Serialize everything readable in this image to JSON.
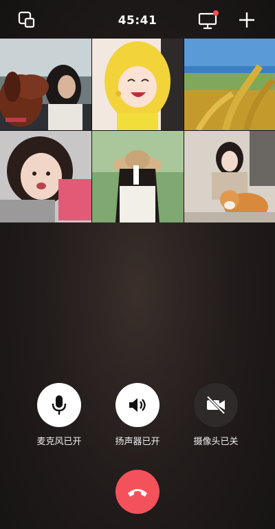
{
  "topbar": {
    "timer": "45:41",
    "icons": [
      "minimize-window-icon",
      "screen-share-icon",
      "add-icon"
    ],
    "notification_dot_color": "#ff4d4f"
  },
  "participants": [
    {
      "id": 1,
      "description": "dog and woman in car"
    },
    {
      "id": 2,
      "description": "cartoon girl avatar"
    },
    {
      "id": 3,
      "description": "rice field"
    },
    {
      "id": 4,
      "description": "child with toy"
    },
    {
      "id": 5,
      "description": "girl with straw hat"
    },
    {
      "id": 6,
      "description": "woman with corgi"
    }
  ],
  "controls": {
    "microphone": {
      "label": "麦克风已开",
      "state": "on",
      "icon": "microphone-icon"
    },
    "speaker": {
      "label": "扬声器已开",
      "state": "on",
      "icon": "speaker-icon"
    },
    "camera": {
      "label": "摄像头已关",
      "state": "off",
      "icon": "camera-off-icon"
    }
  },
  "hangup": {
    "icon": "hangup-icon",
    "color": "#f3525a"
  }
}
